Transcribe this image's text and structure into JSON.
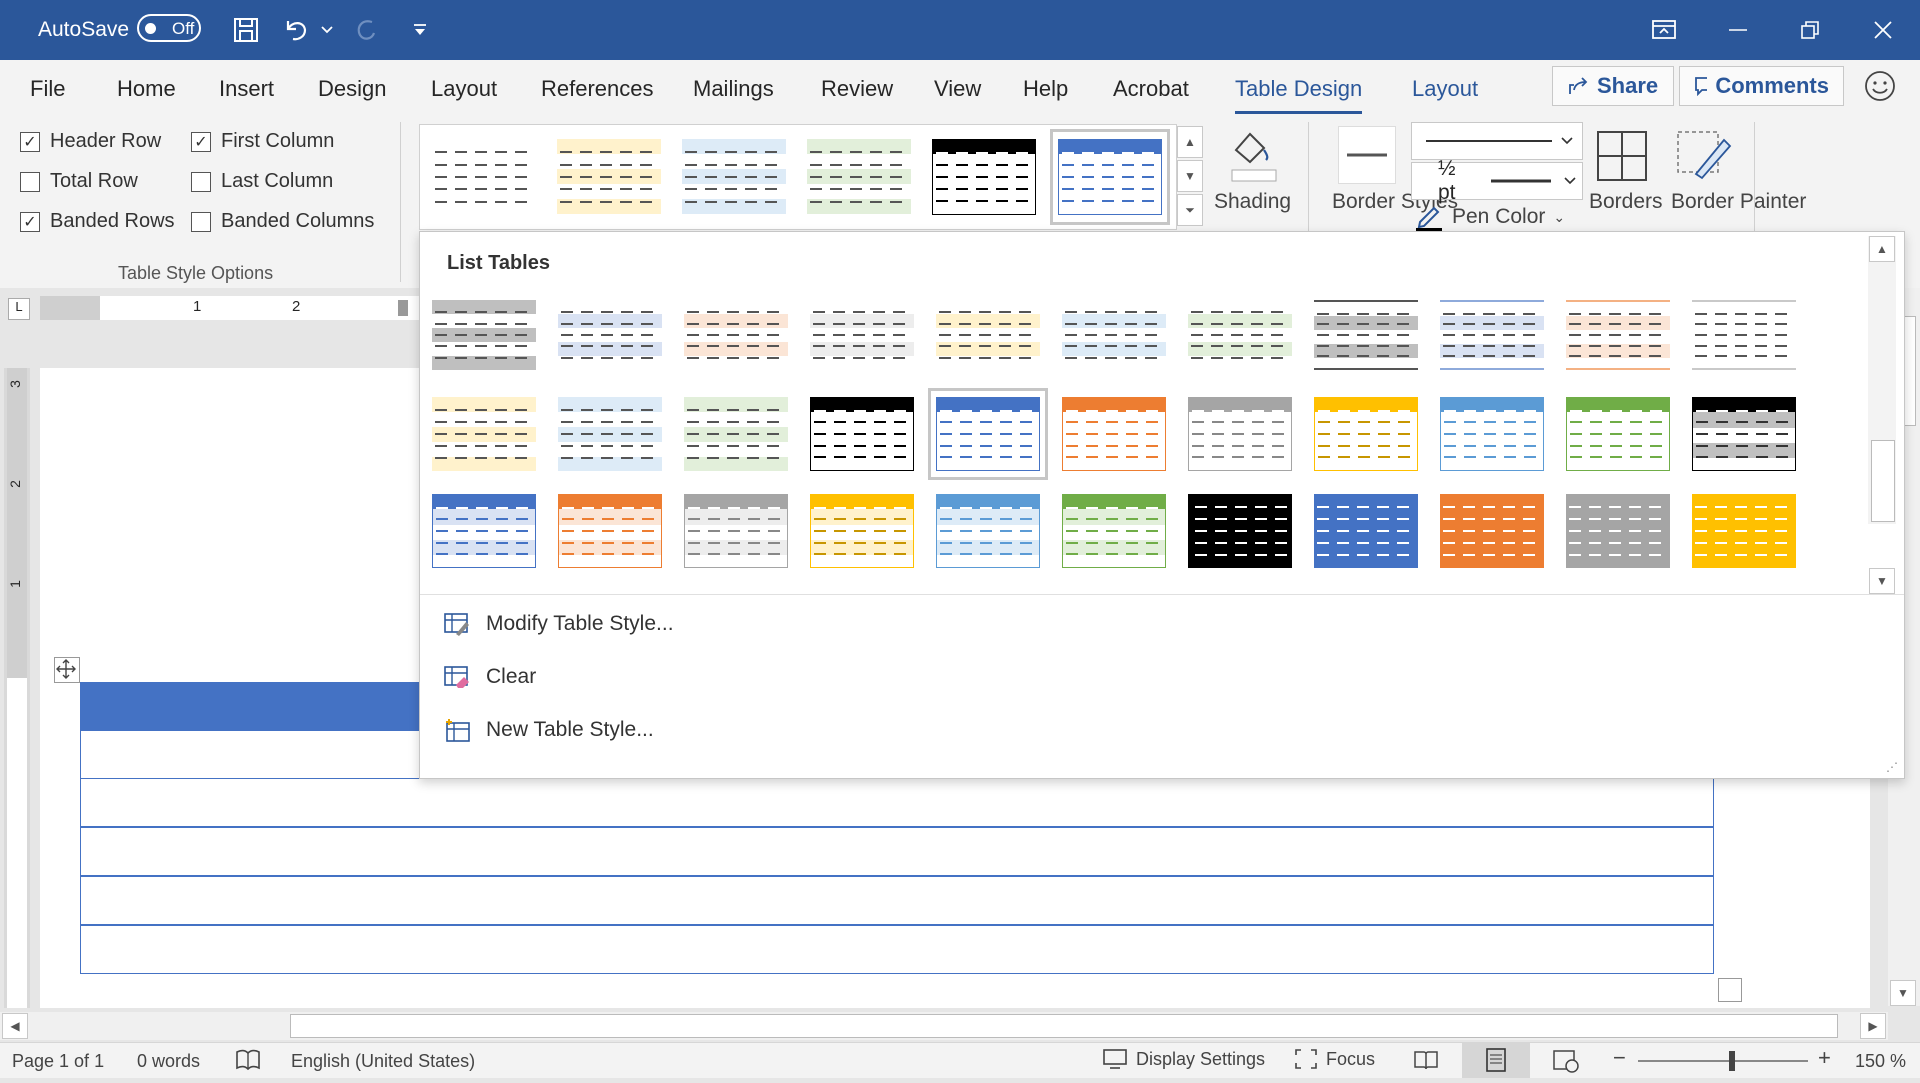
{
  "titlebar": {
    "autosave_label": "AutoSave",
    "autosave_state": "Off",
    "icons": [
      "save-icon",
      "undo-icon",
      "redo-icon",
      "customize-qat-icon",
      "ribbon-display-icon",
      "minimize-icon",
      "restore-icon",
      "close-icon"
    ]
  },
  "tabs": [
    {
      "label": "File"
    },
    {
      "label": "Home"
    },
    {
      "label": "Insert"
    },
    {
      "label": "Design"
    },
    {
      "label": "Layout"
    },
    {
      "label": "References"
    },
    {
      "label": "Mailings"
    },
    {
      "label": "Review"
    },
    {
      "label": "View"
    },
    {
      "label": "Help"
    },
    {
      "label": "Acrobat"
    },
    {
      "label": "Table Design"
    },
    {
      "label": "Layout"
    }
  ],
  "active_tab": "Table Design",
  "share_label": "Share",
  "comments_label": "Comments",
  "table_style_options": {
    "group_label": "Table Style Options",
    "options": [
      {
        "label": "Header Row",
        "checked": true
      },
      {
        "label": "First Column",
        "checked": true
      },
      {
        "label": "Total Row",
        "checked": false
      },
      {
        "label": "Last Column",
        "checked": false
      },
      {
        "label": "Banded Rows",
        "checked": true
      },
      {
        "label": "Banded Columns",
        "checked": false
      }
    ]
  },
  "ribbon": {
    "shading_label": "Shading",
    "border_styles_label": "Border Styles",
    "pen_weight": "½ pt",
    "pen_color_label": "Pen Color",
    "borders_label": "Borders",
    "border_painter_label": "Border Painter"
  },
  "gallery": {
    "section_title": "List Tables",
    "menu": {
      "modify": "Modify Table Style...",
      "clear": "Clear",
      "new": "New Table Style..."
    }
  },
  "colors": {
    "accent": "#2b579a",
    "table_blue": "#4472c4",
    "orange": "#ed7d31",
    "gray": "#a5a5a5",
    "gold": "#ffc000",
    "lightblue": "#5b9bd5",
    "green": "#70ad47"
  },
  "statusbar": {
    "page": "Page 1 of 1",
    "words": "0 words",
    "language": "English (United States)",
    "display_settings": "Display Settings",
    "focus": "Focus",
    "zoom": "150 %"
  },
  "ruler": {
    "top_numbers": [
      "1",
      "2"
    ],
    "left_numbers": [
      "3",
      "2",
      "1"
    ]
  }
}
